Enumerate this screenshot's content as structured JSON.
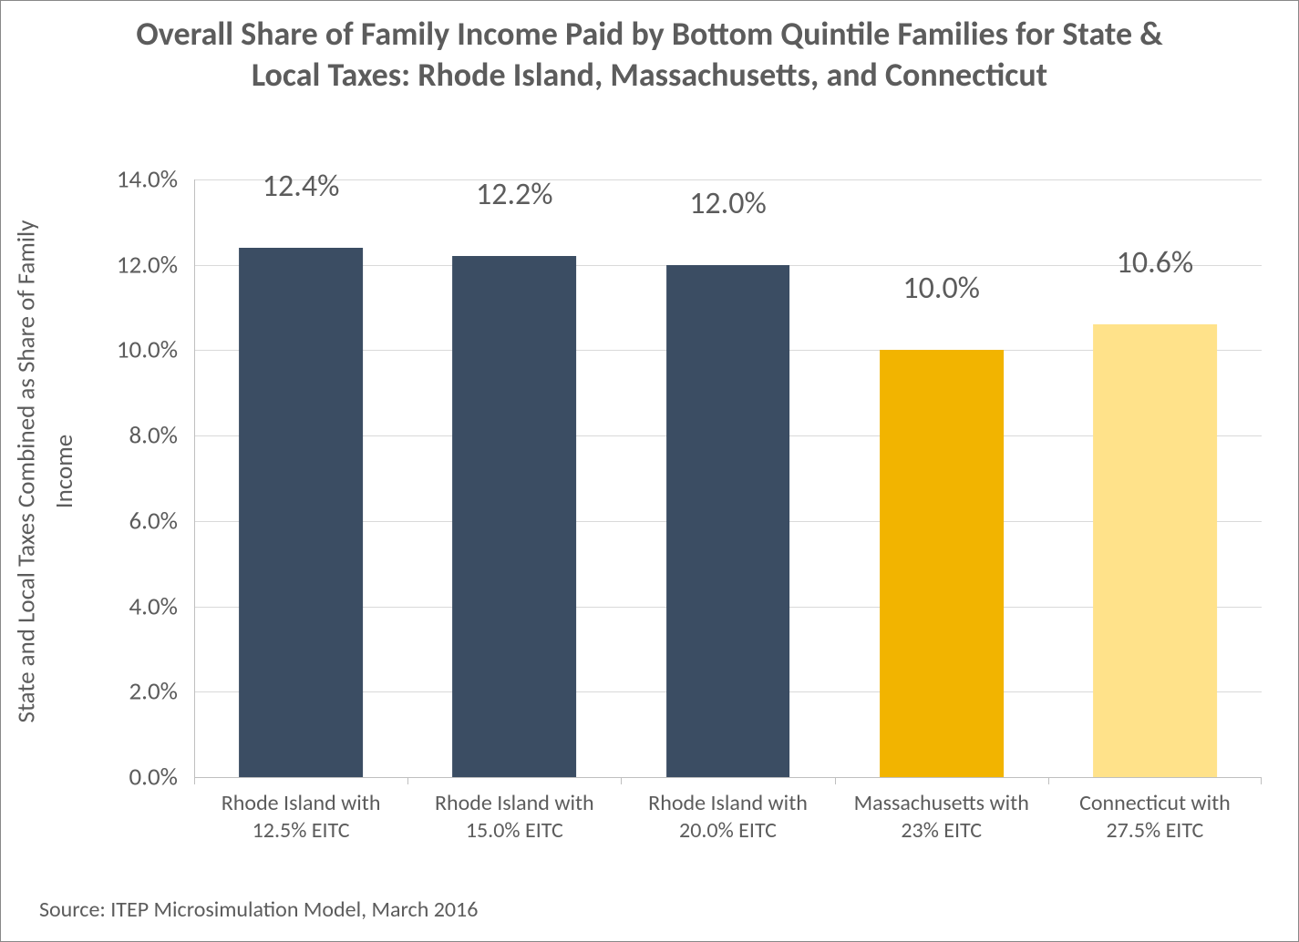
{
  "chart_data": {
    "type": "bar",
    "title": "Overall Share of Family Income Paid by Bottom Quintile Families for State & Local Taxes: Rhode Island, Massachusetts, and Connecticut",
    "ylabel_line1": "State and Local Taxes Combined as Share of Family",
    "ylabel_line2": "Income",
    "xlabel": "",
    "ylim": [
      0,
      14
    ],
    "yticks": [
      "0.0%",
      "2.0%",
      "4.0%",
      "6.0%",
      "8.0%",
      "10.0%",
      "12.0%",
      "14.0%"
    ],
    "categories": [
      "Rhode Island with 12.5% EITC",
      "Rhode Island with 15.0% EITC",
      "Rhode Island with 20.0% EITC",
      "Massachusetts with 23% EITC",
      "Connecticut with 27.5% EITC"
    ],
    "values": [
      12.4,
      12.2,
      12.0,
      10.0,
      10.6
    ],
    "value_labels": [
      "12.4%",
      "12.2%",
      "12.0%",
      "10.0%",
      "10.6%"
    ],
    "colors": [
      "#3b4d63",
      "#3b4d63",
      "#3b4d63",
      "#f2b400",
      "#ffe28a"
    ],
    "source": "Source: ITEP Microsimulation Model, March 2016"
  }
}
